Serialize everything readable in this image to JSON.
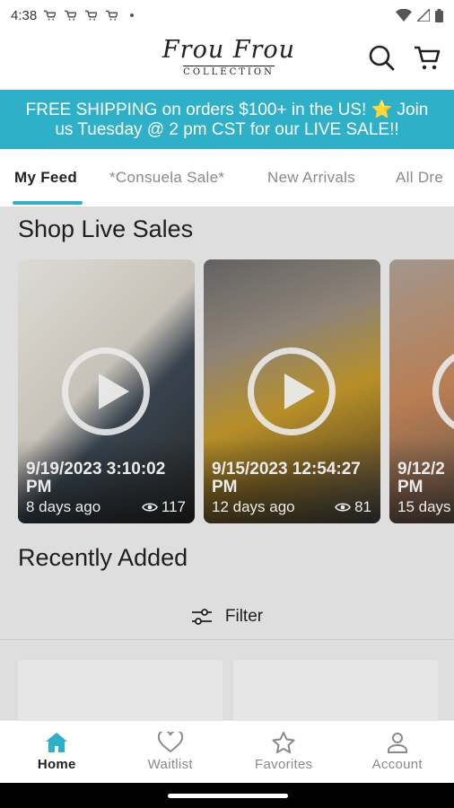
{
  "status_bar": {
    "time": "4:38"
  },
  "header": {
    "logo_script": "Frou Frou",
    "logo_sub": "COLLECTION"
  },
  "banner": {
    "line1": "FREE SHIPPING on orders $100+ in the US! ⭐ Join",
    "line2": "us Tuesday @ 2 pm CST for our LIVE SALE!!"
  },
  "tabs": [
    {
      "label": "My Feed"
    },
    {
      "label": "*Consuela Sale*"
    },
    {
      "label": "New Arrivals"
    },
    {
      "label": "All Dre"
    }
  ],
  "live_sales": {
    "title": "Shop Live Sales",
    "videos": [
      {
        "date": "9/19/2023 3:10:02 PM",
        "ago": "8 days ago",
        "views": "117"
      },
      {
        "date": "9/15/2023 12:54:27 PM",
        "ago": "12 days ago",
        "views": "81"
      },
      {
        "date": "9/12/2 PM",
        "ago": "15 days"
      }
    ]
  },
  "recently_added": {
    "title": "Recently Added",
    "filter_label": "Filter"
  },
  "bottom_nav": [
    {
      "label": "Home",
      "icon": "home-icon"
    },
    {
      "label": "Waitlist",
      "icon": "heart-icon"
    },
    {
      "label": "Favorites",
      "icon": "star-icon"
    },
    {
      "label": "Account",
      "icon": "person-icon"
    }
  ],
  "colors": {
    "accent": "#2fb0c9",
    "banner_bg": "#2fb0c9"
  }
}
